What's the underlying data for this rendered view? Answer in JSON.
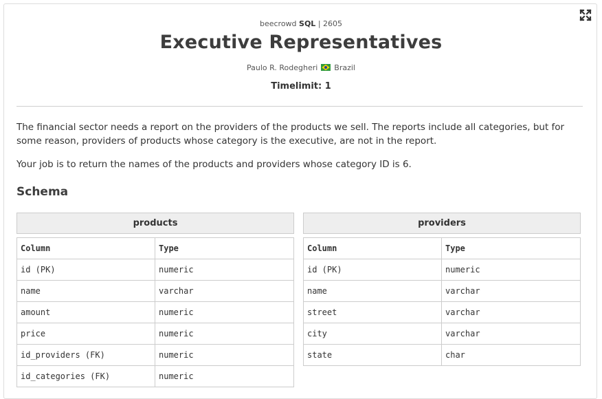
{
  "header": {
    "source_prefix": "beecrowd",
    "source_category": "SQL",
    "source_suffix": "| 2605",
    "title": "Executive Representatives",
    "author": "Paulo R. Rodegheri",
    "country": "Brazil",
    "timelimit": "Timelimit: 1"
  },
  "description": {
    "p1": "The financial sector needs a report on the providers of the products we sell. The reports include all categories, but for some reason, providers of products whose category is the executive, are not in the report.",
    "p2": "Your job is to return the names of the products and providers whose category ID is 6."
  },
  "schema": {
    "heading": "Schema",
    "tables": [
      {
        "name": "products",
        "columns_header": [
          "Column",
          "Type"
        ],
        "rows": [
          [
            "id (PK)",
            "numeric"
          ],
          [
            "name",
            "varchar"
          ],
          [
            "amount",
            "numeric"
          ],
          [
            "price",
            "numeric"
          ],
          [
            "id_providers (FK)",
            "numeric"
          ],
          [
            "id_categories (FK)",
            "numeric"
          ]
        ]
      },
      {
        "name": "providers",
        "columns_header": [
          "Column",
          "Type"
        ],
        "rows": [
          [
            "id (PK)",
            "numeric"
          ],
          [
            "name",
            "varchar"
          ],
          [
            "street",
            "varchar"
          ],
          [
            "city",
            "varchar"
          ],
          [
            "state",
            "char"
          ]
        ]
      }
    ]
  },
  "icons": {
    "expand": "expand-icon",
    "flag": "brazil-flag-icon"
  }
}
